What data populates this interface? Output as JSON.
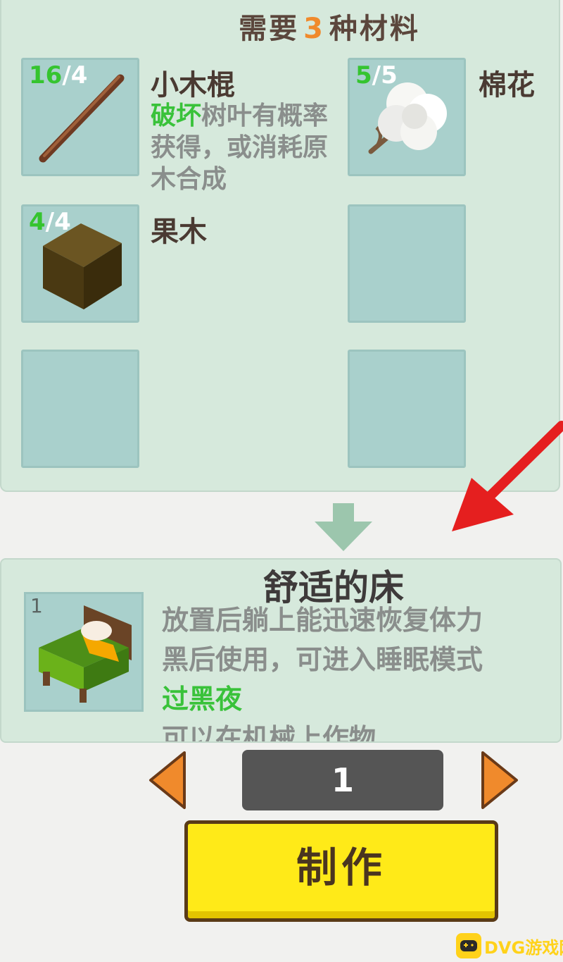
{
  "requirement": {
    "prefix": "需要",
    "count": "3",
    "suffix": "种材料"
  },
  "materials": [
    {
      "name": "小木棍",
      "have": "16",
      "need": "4",
      "icon": "stick-icon",
      "desc_highlight": "破坏",
      "desc_rest": "树叶有概率获得，或消耗原木合成"
    },
    {
      "name": "棉花",
      "have": "5",
      "need": "5",
      "icon": "cotton-icon"
    },
    {
      "name": "果木",
      "have": "4",
      "need": "4",
      "icon": "wood-block-icon"
    }
  ],
  "result": {
    "title": "舒适的床",
    "count": "1",
    "icon": "bed-icon",
    "desc_line1": "放置后躺上能迅速恢复体力",
    "desc_line2": "黑后使用，可进入睡眠模式",
    "highlight": "过黑夜",
    "desc_line4": "可以在机械上作物"
  },
  "quantity": "1",
  "make_button": "制作",
  "watermark": {
    "text": "DVG游戏网"
  },
  "colors": {
    "have_count": "#35c42f",
    "highlight": "#39c23a",
    "button": "#ffea18",
    "arrow": "#f08a2c",
    "annotation_arrow": "#e51f1f"
  }
}
